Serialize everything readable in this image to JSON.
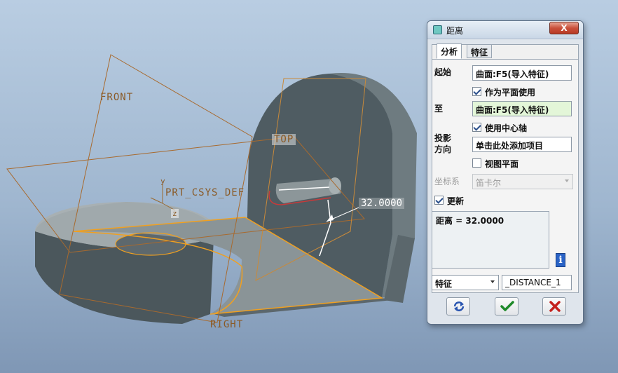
{
  "viewport": {
    "plane_front": "FRONT",
    "plane_top": "TOP",
    "plane_right": "RIGHT",
    "csys_label": "PRT_CSYS_DEF",
    "axis_y": "y",
    "axis_z": "z",
    "dimension_value": "32.0000"
  },
  "dialog": {
    "title": "距离",
    "close_symbol": "X",
    "tabs": [
      {
        "label": "分析",
        "active": true
      },
      {
        "label": "特征",
        "active": false
      }
    ],
    "from_label": "起始",
    "from_value": "曲面:F5(导入特征)",
    "use_as_plane_label": "作为平面使用",
    "use_as_plane_checked": true,
    "to_label": "至",
    "to_value": "曲面:F5(导入特征)",
    "use_center_axis_label": "使用中心轴",
    "use_center_axis_checked": true,
    "projection_label_line1": "投影",
    "projection_label_line2": "方向",
    "projection_value": "单击此处添加项目",
    "view_plane_label": "视图平面",
    "view_plane_checked": false,
    "csys_type_label": "坐标系",
    "csys_type_value": "笛卡尔",
    "update_label": "更新",
    "update_checked": true,
    "result_text": "距离 = 32.0000",
    "info_symbol": "i",
    "feature_select_value": "特征",
    "feature_name_value": "_DISTANCE_1"
  },
  "icons": {
    "repeat": "repeat-icon",
    "ok": "checkmark-icon",
    "cancel": "cross-icon",
    "info": "info-icon"
  },
  "colors": {
    "highlight_edge": "#f0a020",
    "datum_plane": "#8a5a26",
    "ok_green": "#1f8a2a",
    "cancel_red": "#c4201c"
  }
}
